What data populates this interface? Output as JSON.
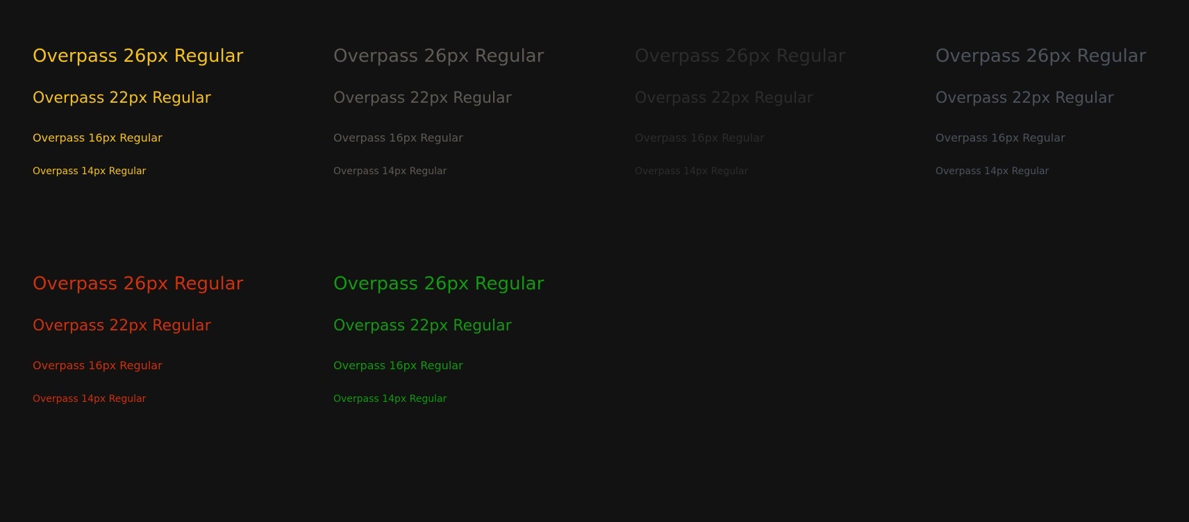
{
  "swatches": [
    {
      "color": "#f5c21a",
      "samples": [
        "Overpass 26px Regular",
        "Overpass 22px Regular",
        "Overpass 16px Regular",
        "Overpass 14px Regular"
      ]
    },
    {
      "color": "#5e5b56",
      "samples": [
        "Overpass 26px Regular",
        "Overpass 22px Regular",
        "Overpass 16px Regular",
        "Overpass 14px Regular"
      ]
    },
    {
      "color": "#2c2c2c",
      "samples": [
        "Overpass 26px Regular",
        "Overpass 22px Regular",
        "Overpass 16px Regular",
        "Overpass 14px Regular"
      ]
    },
    {
      "color": "#4e525c",
      "samples": [
        "Overpass 26px Regular",
        "Overpass 22px Regular",
        "Overpass 16px Regular",
        "Overpass 14px Regular"
      ]
    },
    {
      "color": "#d0300c",
      "samples": [
        "Overpass 26px Regular",
        "Overpass 22px Regular",
        "Overpass 16px Regular",
        "Overpass 14px Regular"
      ]
    },
    {
      "color": "#119a10",
      "samples": [
        "Overpass 26px Regular",
        "Overpass 22px Regular",
        "Overpass 16px Regular",
        "Overpass 14px Regular"
      ]
    }
  ]
}
